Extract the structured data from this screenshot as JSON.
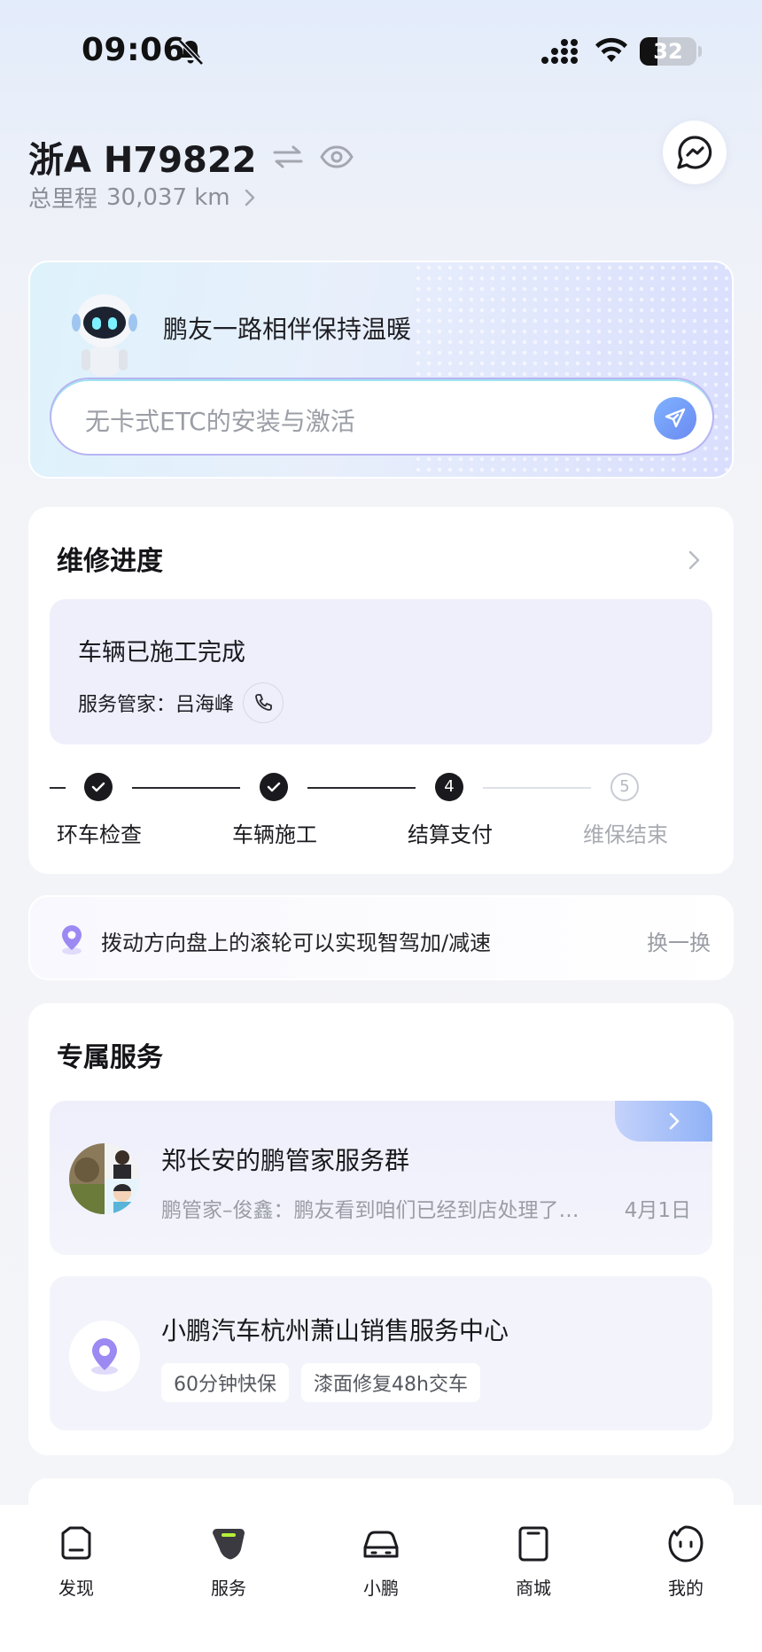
{
  "status_bar": {
    "time": "09:06",
    "battery": "32",
    "battery_level": 0.32
  },
  "vehicle": {
    "plate": "浙A H79822",
    "mileage_label": "总里程",
    "mileage_value": "30,037 km"
  },
  "assistant": {
    "greeting": "鹏友一路相伴保持温暖",
    "input_placeholder": "无卡式ETC的安装与激活"
  },
  "repair": {
    "title": "维修进度",
    "status": "车辆已施工完成",
    "advisor_label": "服务管家：",
    "advisor_name": "吕海峰",
    "steps": [
      {
        "label": "环车检查",
        "marker": "",
        "state": "done"
      },
      {
        "label": "车辆施工",
        "marker": "",
        "state": "done"
      },
      {
        "label": "结算支付",
        "marker": "4",
        "state": "current"
      },
      {
        "label": "维保结束",
        "marker": "5",
        "state": "pending"
      }
    ]
  },
  "tip": {
    "text": "拨动方向盘上的滚轮可以实现智驾加/减速",
    "refresh_label": "换一换"
  },
  "services": {
    "title": "专属服务",
    "group_chat": {
      "title": "郑长安的鹏管家服务群",
      "message": "鹏管家–俊鑫：鹏友看到咱们已经到店处理了…",
      "date": "4月1日"
    },
    "store": {
      "title": "小鹏汽车杭州萧山销售服务中心",
      "tags": [
        "60分钟快保",
        "漆面修复48h交车"
      ]
    }
  },
  "tabbar": {
    "items": [
      {
        "label": "发现",
        "icon": "discover-icon",
        "active": false
      },
      {
        "label": "服务",
        "icon": "service-icon",
        "active": true
      },
      {
        "label": "小鹏",
        "icon": "car-icon",
        "active": false
      },
      {
        "label": "商城",
        "icon": "mall-icon",
        "active": false
      },
      {
        "label": "我的",
        "icon": "profile-icon",
        "active": false
      }
    ]
  },
  "colors": {
    "accent_purple": "#8a7df0",
    "active_tab": "#3a3a40",
    "active_tab_highlight": "#b4f03a",
    "text_secondary": "#9a9da5"
  }
}
